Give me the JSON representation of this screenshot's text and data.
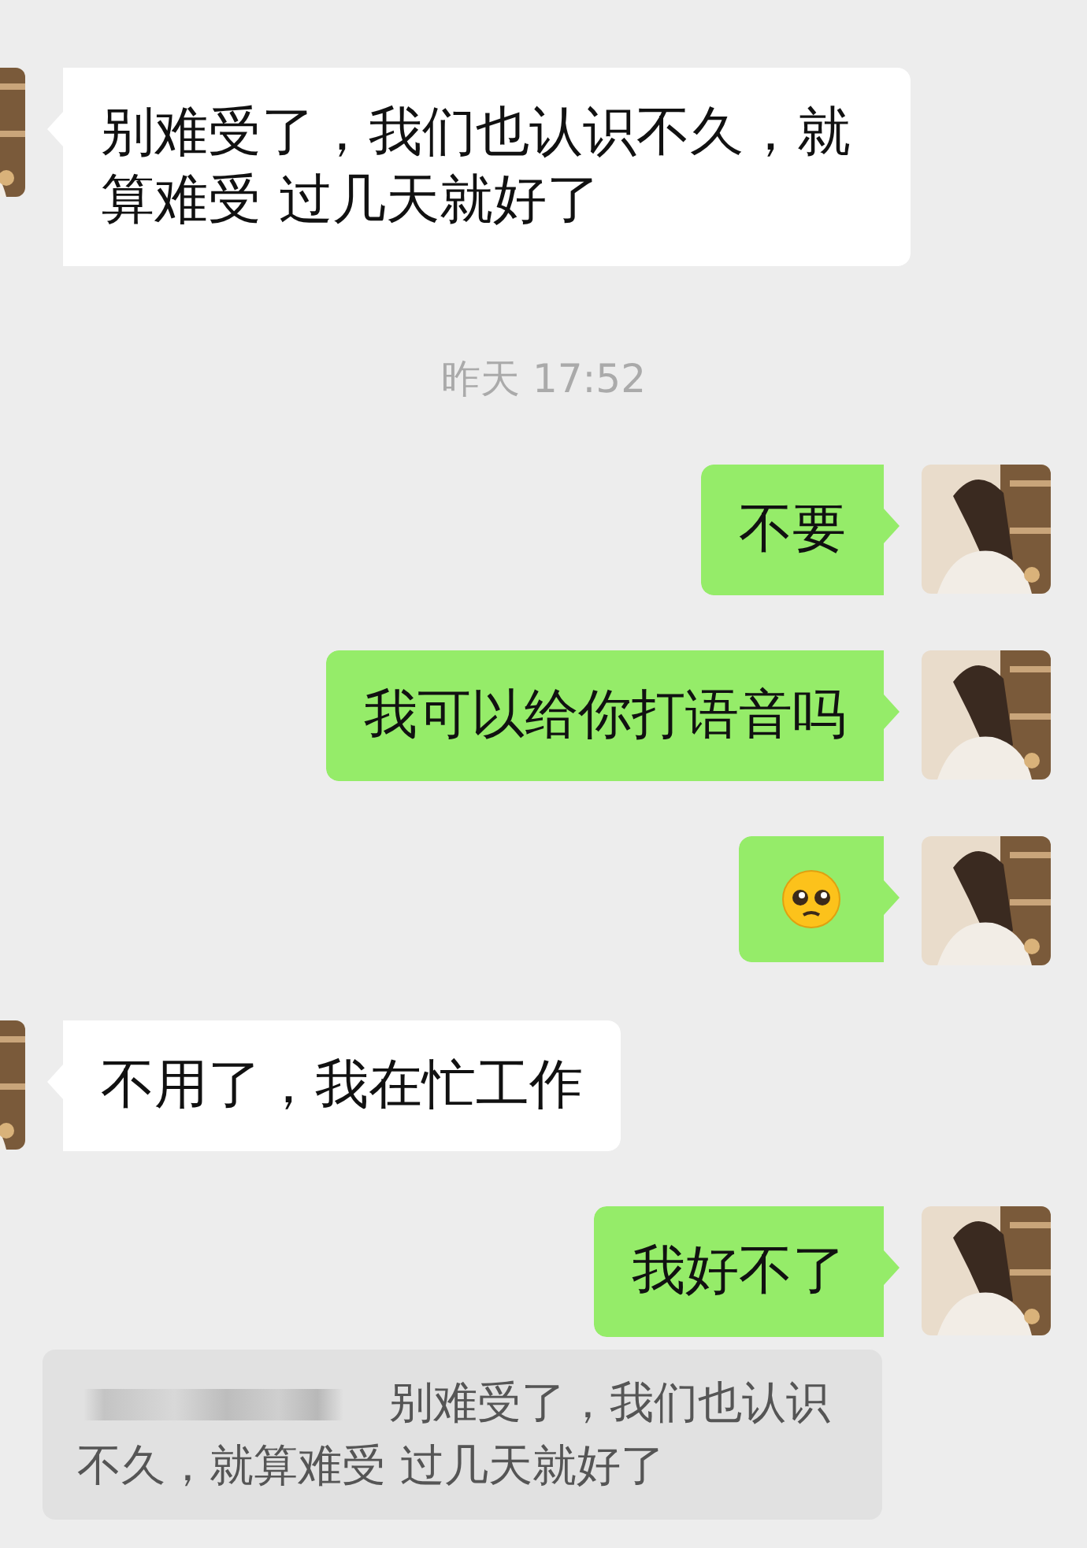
{
  "messages": [
    {
      "kind": "in",
      "text": "别难受了，我们也认识不久，就算难受 过几天就好了"
    },
    {
      "kind": "time",
      "text": "昨天 17:52"
    },
    {
      "kind": "out",
      "text": "不要"
    },
    {
      "kind": "out",
      "text": "我可以给你打语音吗"
    },
    {
      "kind": "emoji"
    },
    {
      "kind": "in",
      "text": "不用了，我在忙工作"
    },
    {
      "kind": "out",
      "text": "我好不了"
    }
  ],
  "quote": {
    "text": "别难受了，我们也认识不久，就算难受 过几天就好了"
  }
}
